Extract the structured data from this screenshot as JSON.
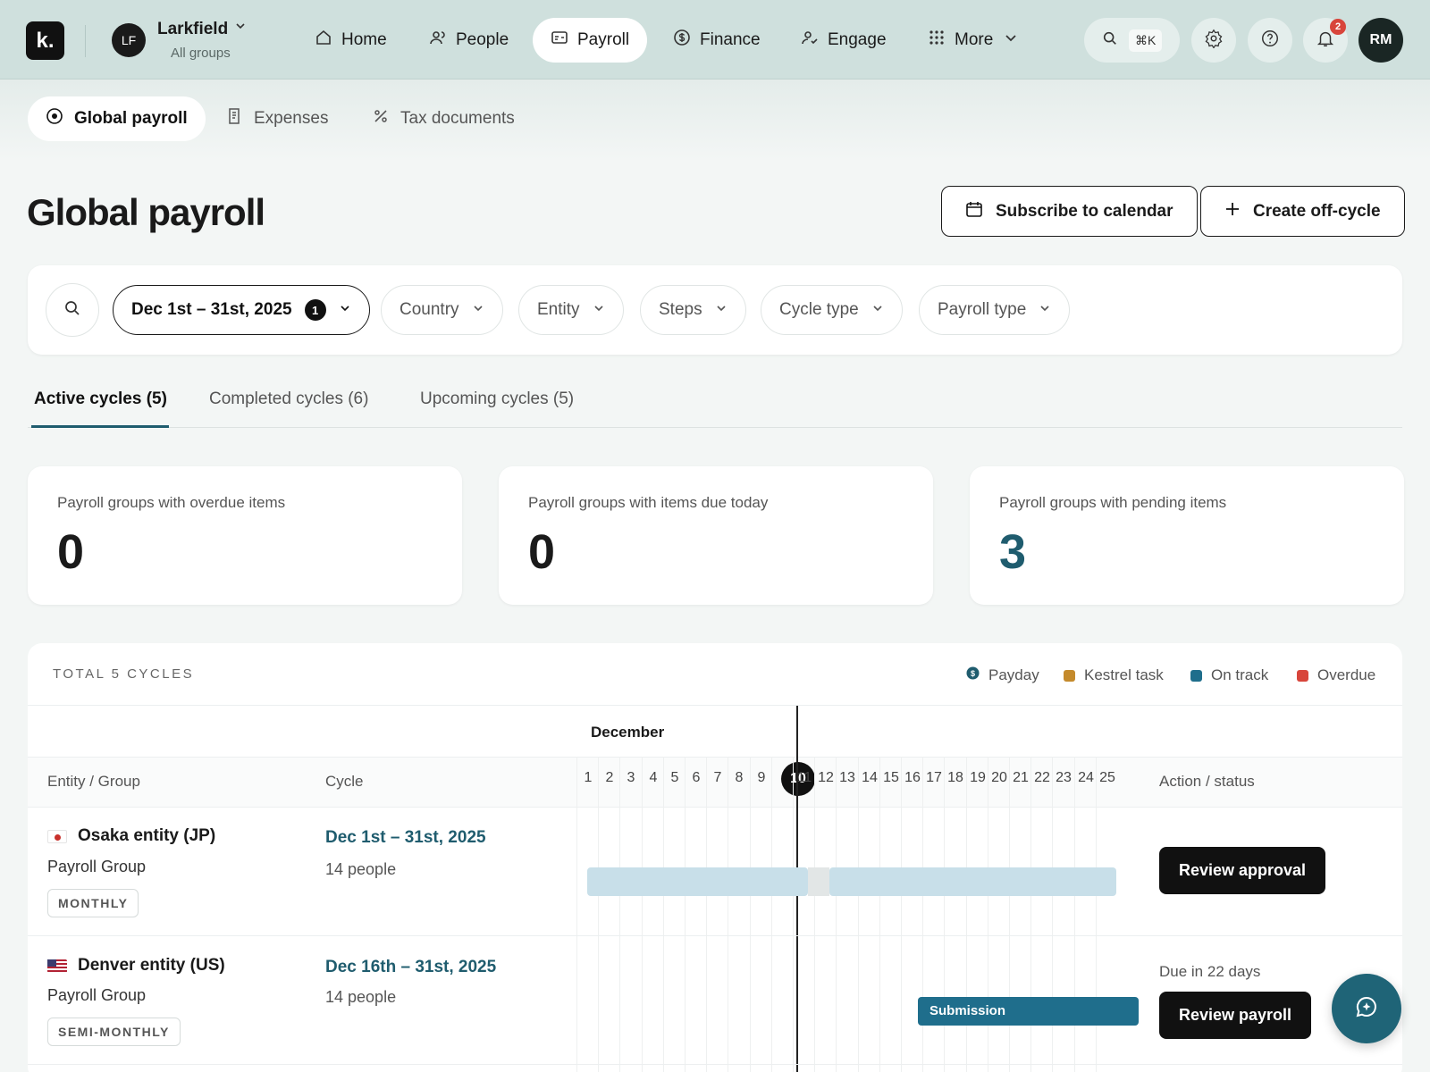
{
  "topbar": {
    "logo": "k.",
    "org": {
      "initials": "LF",
      "name": "Larkfield",
      "subtitle": "All groups"
    },
    "nav": [
      {
        "label": "Home",
        "icon": "home-icon"
      },
      {
        "label": "People",
        "icon": "people-icon"
      },
      {
        "label": "Payroll",
        "icon": "payroll-icon",
        "active": true
      },
      {
        "label": "Finance",
        "icon": "dollar-icon"
      },
      {
        "label": "Engage",
        "icon": "engage-icon"
      },
      {
        "label": "More",
        "icon": "grid-icon"
      }
    ],
    "search_shortcut": "⌘K",
    "notifications_count": "2",
    "user_initials": "RM"
  },
  "subnav": {
    "tabs": [
      {
        "label": "Global payroll",
        "active": true
      },
      {
        "label": "Expenses"
      },
      {
        "label": "Tax documents"
      }
    ]
  },
  "page": {
    "title": "Global payroll",
    "subscribe_label": "Subscribe to calendar",
    "create_label": "Create off-cycle"
  },
  "filters": {
    "date_range": "Dec 1st – 31st, 2025",
    "date_count": "1",
    "chips": [
      "Country",
      "Entity",
      "Steps",
      "Cycle type",
      "Payroll type"
    ]
  },
  "cycle_tabs": [
    {
      "label": "Active cycles (5)",
      "active": true
    },
    {
      "label": "Completed cycles (6)"
    },
    {
      "label": "Upcoming cycles (5)"
    }
  ],
  "stats": [
    {
      "label": "Payroll groups with overdue items",
      "value": "0"
    },
    {
      "label": "Payroll groups with items due today",
      "value": "0"
    },
    {
      "label": "Payroll groups with pending items",
      "value": "3"
    }
  ],
  "gantt": {
    "total_label": "TOTAL 5 CYCLES",
    "legend": [
      {
        "label": "Payday",
        "color": "#1f5c6e"
      },
      {
        "label": "Kestrel task",
        "color": "#c48a2c"
      },
      {
        "label": "On track",
        "color": "#1f6e8c"
      },
      {
        "label": "Overdue",
        "color": "#d8453b"
      }
    ],
    "month": "December",
    "col_entity": "Entity / Group",
    "col_cycle": "Cycle",
    "col_action": "Action / status",
    "days": [
      "1",
      "2",
      "3",
      "4",
      "5",
      "6",
      "7",
      "8",
      "9",
      "10",
      "11",
      "12",
      "13",
      "14",
      "15",
      "16",
      "17",
      "18",
      "19",
      "20",
      "21",
      "22",
      "23",
      "24",
      "25"
    ],
    "today": "10",
    "rows": [
      {
        "entity": "Osaka entity (JP)",
        "group": "Payroll Group",
        "frequency": "MONTHLY",
        "cycle": "Dec 1st – 31st, 2025",
        "people": "14 people",
        "action": "Review approval",
        "status": ""
      },
      {
        "entity": "Denver entity (US)",
        "group": "Payroll Group",
        "frequency": "SEMI-MONTHLY",
        "cycle": "Dec 16th – 31st, 2025",
        "people": "14 people",
        "action": "Review payroll",
        "status": "Due in 22 days",
        "bar_label": "Submission"
      }
    ]
  }
}
